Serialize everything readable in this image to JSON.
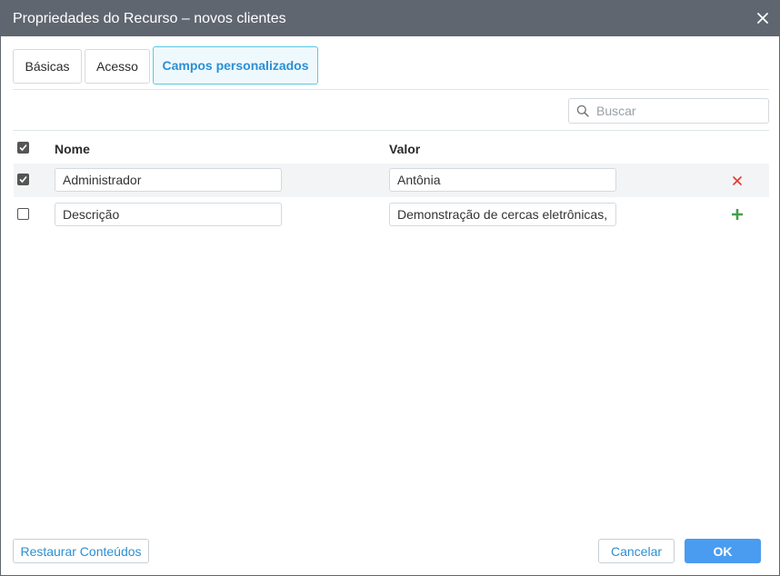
{
  "window": {
    "title": "Propriedades do Recurso – novos clientes"
  },
  "tabs": [
    {
      "label": "Básicas",
      "active": false
    },
    {
      "label": "Acesso",
      "active": false
    },
    {
      "label": "Campos personalizados",
      "active": true
    }
  ],
  "search": {
    "placeholder": "Buscar",
    "value": ""
  },
  "table": {
    "columns": [
      "Nome",
      "Valor"
    ],
    "select_all_checked": true,
    "rows": [
      {
        "checked": true,
        "name": "Administrador",
        "value": "Antônia",
        "action": "delete"
      },
      {
        "checked": false,
        "name": "Descrição",
        "value": "Demonstração de cercas eletrônicas,",
        "action": "add"
      }
    ]
  },
  "footer": {
    "restore_label": "Restaurar Conteúdos",
    "cancel_label": "Cancelar",
    "ok_label": "OK"
  },
  "colors": {
    "titlebar": "#5f6670",
    "accent": "#2c8fd4",
    "primary_button": "#4a9cf0",
    "active_tab_border": "#5bc8e4",
    "delete_icon": "#e53935",
    "add_icon": "#43a047"
  },
  "icons": {
    "close": "close-icon",
    "search": "search-icon",
    "delete": "close-icon",
    "add": "plus-icon",
    "check": "checkmark-icon"
  }
}
